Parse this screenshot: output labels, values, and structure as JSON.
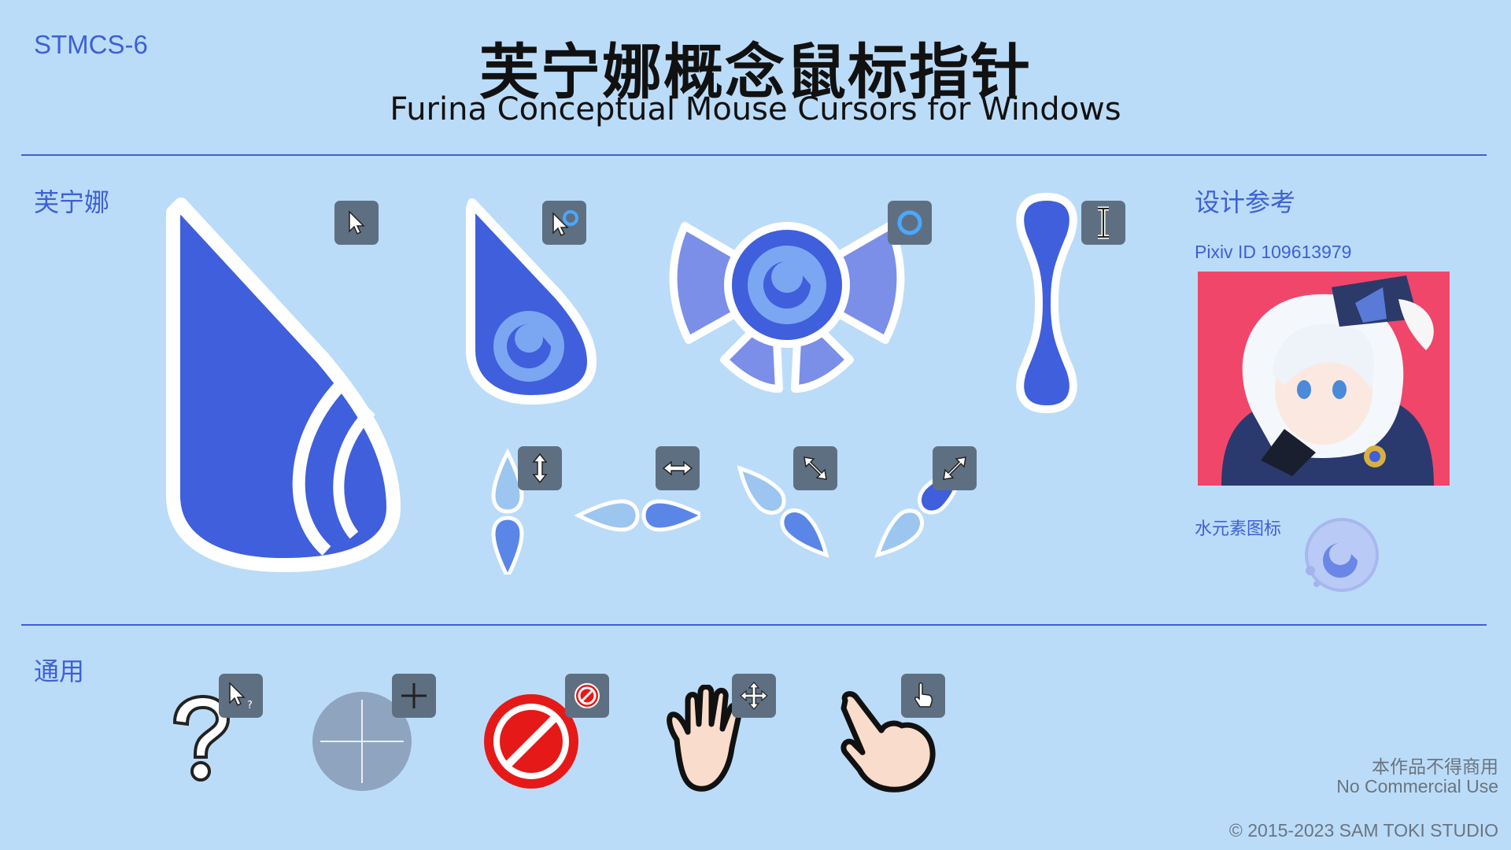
{
  "header": {
    "code": "STMCS-6",
    "title_cn": "芙宁娜概念鼠标指针",
    "title_en": "Furina Conceptual Mouse Cursors for Windows"
  },
  "sections": {
    "furina": "芙宁娜",
    "common": "通用",
    "reference": "设计参考"
  },
  "reference": {
    "pixiv": "Pixiv ID 109613979",
    "hydro_label": "水元素图标"
  },
  "cursors": {
    "furina": [
      "normal-select",
      "working-in-background",
      "busy",
      "text-select",
      "vertical-resize",
      "horizontal-resize",
      "diagonal-resize-1",
      "diagonal-resize-2"
    ],
    "common": [
      "help-select",
      "precision-select",
      "unavailable",
      "move",
      "link-select"
    ]
  },
  "colors": {
    "background": "#bbdcf8",
    "accent": "#3e60d6",
    "drop_blue": "#3f5fdc",
    "light_blue": "#9cc6f0",
    "bow": "#7b8ee8",
    "badge": "#5f6f82",
    "no_red": "#e61919",
    "hand_skin": "#f9dccb"
  },
  "footer": {
    "no_commercial_cn": "本作品不得商用",
    "no_commercial_en": "No Commercial Use",
    "copyright": "© 2015-2023 SAM TOKI STUDIO"
  }
}
